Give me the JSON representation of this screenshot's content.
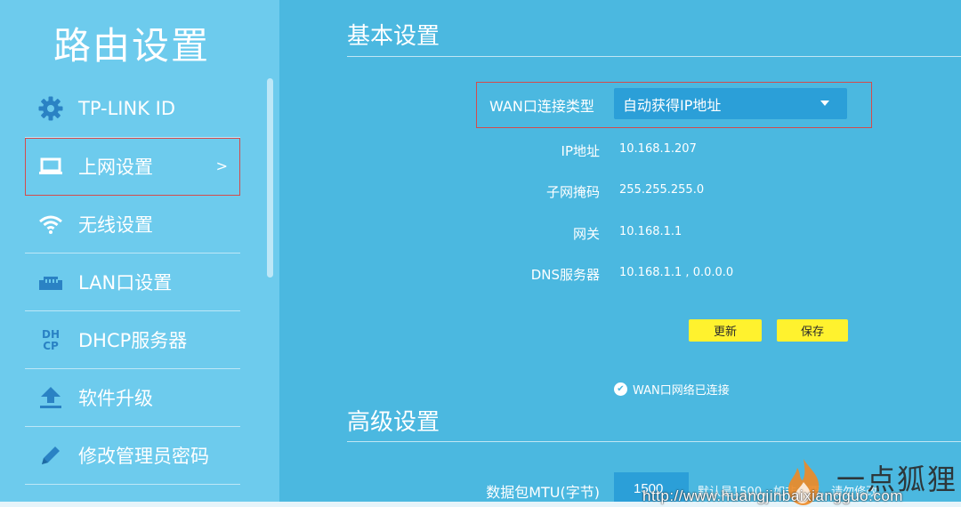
{
  "sidebar": {
    "title": "路由设置",
    "items": [
      {
        "label": "TP-LINK ID",
        "icon": "gear-icon"
      },
      {
        "label": "上网设置",
        "icon": "laptop-icon",
        "arrow": ">"
      },
      {
        "label": "无线设置",
        "icon": "wifi-icon"
      },
      {
        "label": "LAN口设置",
        "icon": "lan-port-icon"
      },
      {
        "label": "DHCP服务器",
        "icon": "dhcp-icon",
        "icon_text_top": "DH",
        "icon_text_bottom": "CP"
      },
      {
        "label": "软件升级",
        "icon": "upload-icon"
      },
      {
        "label": "修改管理员密码",
        "icon": "pencil-icon"
      }
    ]
  },
  "main": {
    "basic_title": "基本设置",
    "wan": {
      "label": "WAN口连接类型",
      "selected": "自动获得IP地址"
    },
    "rows": [
      {
        "label": "IP地址",
        "value": "10.168.1.207"
      },
      {
        "label": "子网掩码",
        "value": "255.255.255.0"
      },
      {
        "label": "网关",
        "value": "10.168.1.1"
      },
      {
        "label": "DNS服务器",
        "value": "10.168.1.1 , 0.0.0.0"
      }
    ],
    "buttons": {
      "refresh": "更新",
      "save": "保存"
    },
    "status": "WAN口网络已连接",
    "advanced_title": "高级设置",
    "mtu": {
      "label": "数据包MTU(字节)",
      "value": "1500",
      "hint": "默认是1500，如非必要，请勿修改"
    }
  },
  "watermark": {
    "brand": "一点狐狸",
    "url": "http://www.huangjinbaixiangguo.com"
  },
  "colors": {
    "main_bg": "#4bb8e0",
    "sidebar_bg": "#6dcbed",
    "button_yellow": "#fff22e",
    "highlight_red": "#d44b4b"
  }
}
